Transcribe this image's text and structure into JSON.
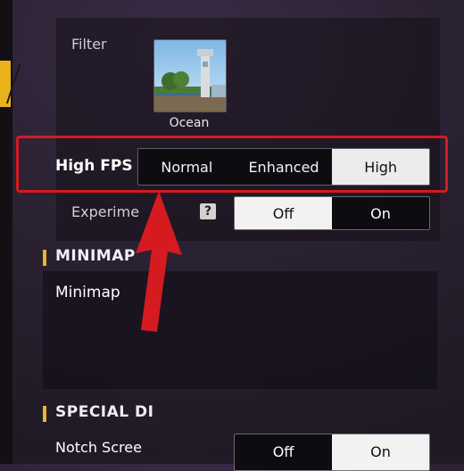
{
  "graphics": {
    "filter": {
      "label": "Filter",
      "thumbnail_label": "Ocean"
    },
    "high_fps": {
      "label": "High FPS",
      "options": [
        "Normal",
        "Enhanced",
        "High"
      ],
      "selected": "High"
    },
    "experimental": {
      "label": "Experime",
      "help_icon": "?",
      "options": [
        "Off",
        "On"
      ],
      "selected": "Off"
    }
  },
  "sections": {
    "minimap": {
      "title": "MINIMAP",
      "label": "Minimap"
    },
    "special": {
      "title": "SPECIAL DI",
      "notch_label": "Notch Scree",
      "options": [
        "Off",
        "On"
      ],
      "selected": "Off"
    }
  },
  "colors": {
    "highlight_red": "#d51a20",
    "section_accent": "#f0b12b",
    "selected_bg": "#ececec"
  }
}
